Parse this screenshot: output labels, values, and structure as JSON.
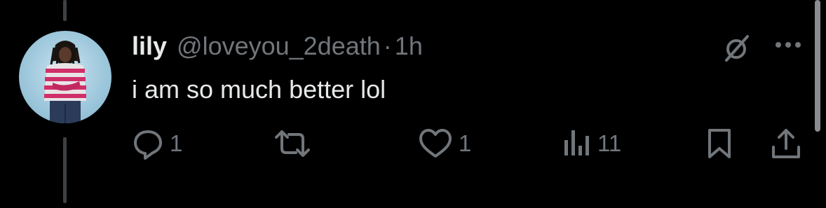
{
  "tweet": {
    "display_name": "lily",
    "handle": "@loveyou_2death",
    "separator": "·",
    "time": "1h",
    "text": "i am so much better lol"
  },
  "actions": {
    "reply": {
      "icon": "reply-icon",
      "count": "1"
    },
    "retweet": {
      "icon": "retweet-icon",
      "count": ""
    },
    "like": {
      "icon": "heart-icon",
      "count": "1"
    },
    "views": {
      "icon": "views-chart-icon",
      "count": "11"
    },
    "bookmark": {
      "icon": "bookmark-icon"
    },
    "share": {
      "icon": "share-icon"
    }
  },
  "top_icons": [
    "grok-icon",
    "more-icon"
  ],
  "colors": {
    "background": "#000000",
    "primary_text": "#e7e9ea",
    "secondary_text": "#71767b",
    "thread_line": "#3e4144"
  }
}
